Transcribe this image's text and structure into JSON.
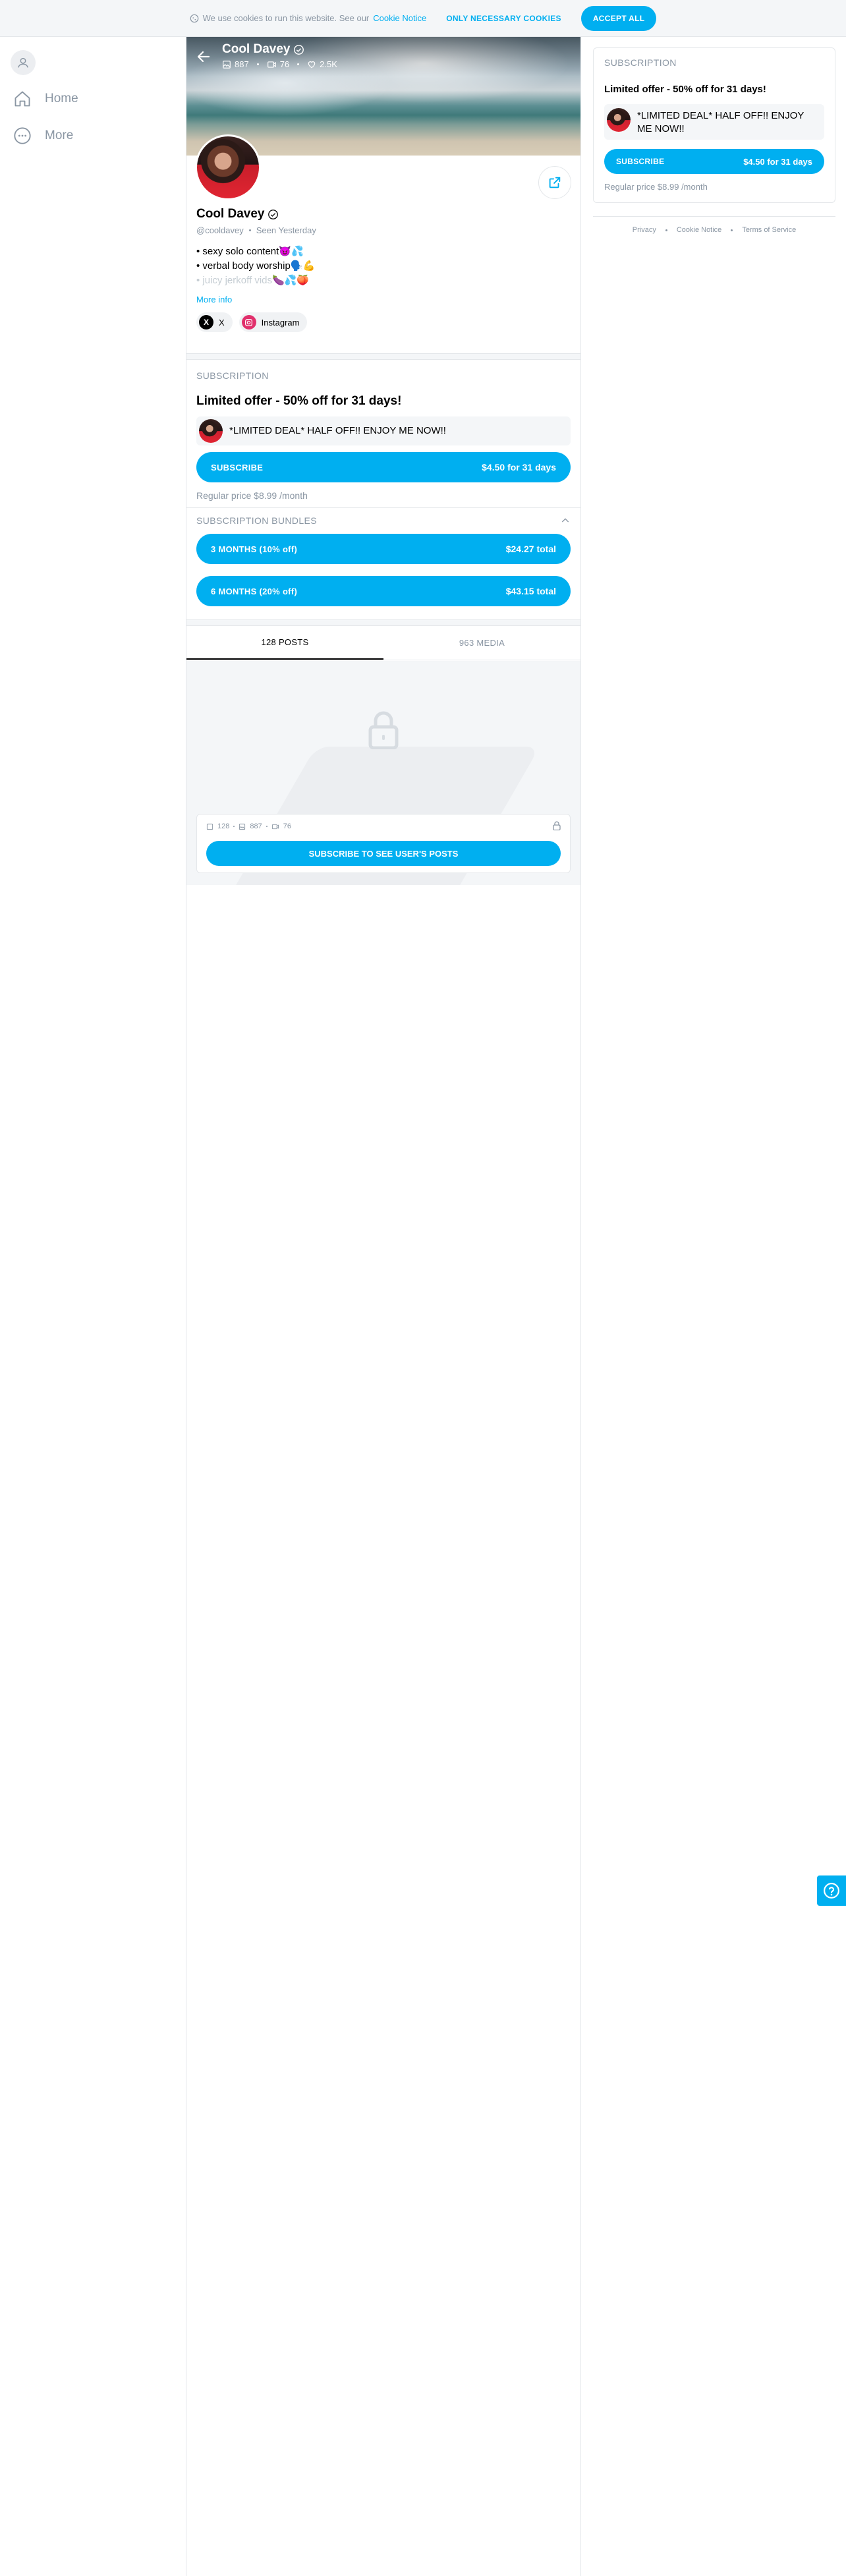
{
  "cookie": {
    "message": "We use cookies to run this website. See our",
    "link": "Cookie Notice",
    "necessary_label": "ONLY NECESSARY COOKIES",
    "accept_label": "ACCEPT ALL"
  },
  "nav": {
    "items": [
      {
        "label": "Home",
        "icon": "home-icon"
      },
      {
        "label": "More",
        "icon": "more-circle-icon"
      }
    ]
  },
  "profile": {
    "name": "Cool Davey",
    "handle": "@cooldavey",
    "seen": "Seen Yesterday",
    "stats": {
      "posts": "887",
      "videos": "76",
      "likes": "2.5K"
    },
    "bio_lines": [
      "• sexy solo content😈💦",
      "• verbal body worship🗣️💪",
      "• juicy jerkoff vids🍆💦🍑"
    ],
    "more_info": "More info",
    "socials": [
      {
        "label": "X",
        "icon": "x-logo-icon",
        "color": "#000000"
      },
      {
        "label": "Instagram",
        "icon": "instagram-icon",
        "color": "#e1306c"
      }
    ]
  },
  "subscription": {
    "section_title": "SUBSCRIPTION",
    "offer_title": "Limited offer - 50% off for 31 days!",
    "offer_message": "*LIMITED DEAL* HALF OFF!! ENJOY ME NOW!!",
    "subscribe_label": "SUBSCRIBE",
    "subscribe_price": "$4.50 for 31 days",
    "regular_price": "Regular price $8.99 /month"
  },
  "bundles": {
    "title": "SUBSCRIPTION BUNDLES",
    "items": [
      {
        "label": "3 MONTHS (10% off)",
        "price": "$24.27 total"
      },
      {
        "label": "6 MONTHS (20% off)",
        "price": "$43.15 total"
      }
    ]
  },
  "tabs": [
    {
      "label": "128 POSTS",
      "active": true
    },
    {
      "label": "963 MEDIA",
      "active": false
    }
  ],
  "locked": {
    "stats": {
      "posts": "128",
      "photos": "887",
      "videos": "76"
    },
    "cta": "SUBSCRIBE TO SEE USER'S POSTS"
  },
  "footer": {
    "links": [
      "Privacy",
      "Cookie Notice",
      "Terms of Service"
    ]
  },
  "colors": {
    "accent": "#00aff0",
    "muted": "#8a96a3",
    "border": "#e4e7ea"
  }
}
